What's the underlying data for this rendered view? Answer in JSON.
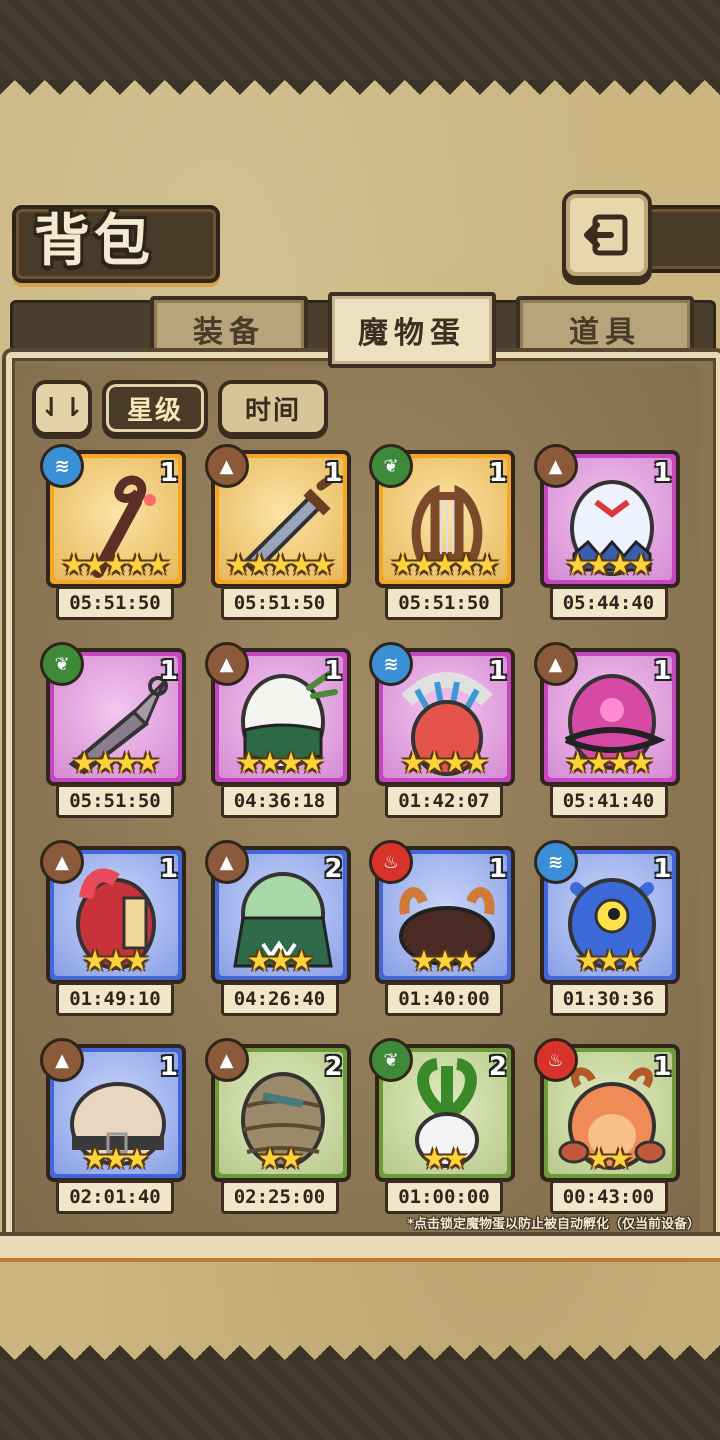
{
  "header": {
    "title": "背包"
  },
  "tabs": [
    {
      "label": "装备",
      "active": false
    },
    {
      "label": "魔物蛋",
      "active": true
    },
    {
      "label": "道具",
      "active": false
    }
  ],
  "sort": {
    "toggle_label": "⇃⇂",
    "star_label": "星级",
    "time_label": "时间",
    "selected": "星级"
  },
  "items": [
    {
      "element": "water",
      "qty": "1",
      "stars": "★★★★★",
      "rarity": "orange",
      "timer": "05:51:50",
      "art": "staff"
    },
    {
      "element": "earth",
      "qty": "1",
      "stars": "★★★★★",
      "rarity": "orange",
      "timer": "05:51:50",
      "art": "sword"
    },
    {
      "element": "wind",
      "qty": "1",
      "stars": "★★★★★",
      "rarity": "orange",
      "timer": "05:51:50",
      "art": "lyre"
    },
    {
      "element": "earth",
      "qty": "1",
      "stars": "★★★★",
      "rarity": "purple",
      "timer": "05:44:40",
      "art": "crystal-egg"
    },
    {
      "element": "wind",
      "qty": "1",
      "stars": "★★★★",
      "rarity": "purple",
      "timer": "05:51:50",
      "art": "kunai"
    },
    {
      "element": "earth",
      "qty": "1",
      "stars": "★★★★",
      "rarity": "purple",
      "timer": "04:36:18",
      "art": "wrapped-egg"
    },
    {
      "element": "water",
      "qty": "1",
      "stars": "★★★★",
      "rarity": "purple",
      "timer": "01:42:07",
      "art": "feather-egg"
    },
    {
      "element": "earth",
      "qty": "1",
      "stars": "★★★★",
      "rarity": "purple",
      "timer": "05:41:40",
      "art": "thorn-egg"
    },
    {
      "element": "earth",
      "qty": "1",
      "stars": "★★★",
      "rarity": "blue",
      "timer": "01:49:10",
      "art": "helmet-egg"
    },
    {
      "element": "earth",
      "qty": "2",
      "stars": "★★★",
      "rarity": "blue",
      "timer": "04:26:40",
      "art": "hooded-egg"
    },
    {
      "element": "fire",
      "qty": "1",
      "stars": "★★★",
      "rarity": "blue",
      "timer": "01:40:00",
      "art": "fur-egg"
    },
    {
      "element": "water",
      "qty": "1",
      "stars": "★★★",
      "rarity": "blue",
      "timer": "01:30:36",
      "art": "eye-egg"
    },
    {
      "element": "earth",
      "qty": "1",
      "stars": "★★★",
      "rarity": "blue",
      "timer": "02:01:40",
      "art": "hairy-egg"
    },
    {
      "element": "earth",
      "qty": "2",
      "stars": "★★",
      "rarity": "green",
      "timer": "02:25:00",
      "art": "basket-egg"
    },
    {
      "element": "wind",
      "qty": "2",
      "stars": "★★",
      "rarity": "green",
      "timer": "01:00:00",
      "art": "radish-egg"
    },
    {
      "element": "fire",
      "qty": "1",
      "stars": "★★",
      "rarity": "green",
      "timer": "00:43:00",
      "art": "crab-egg"
    }
  ],
  "footnote": "*点击锁定魔物蛋以防止被自动孵化（仅当前设备）"
}
